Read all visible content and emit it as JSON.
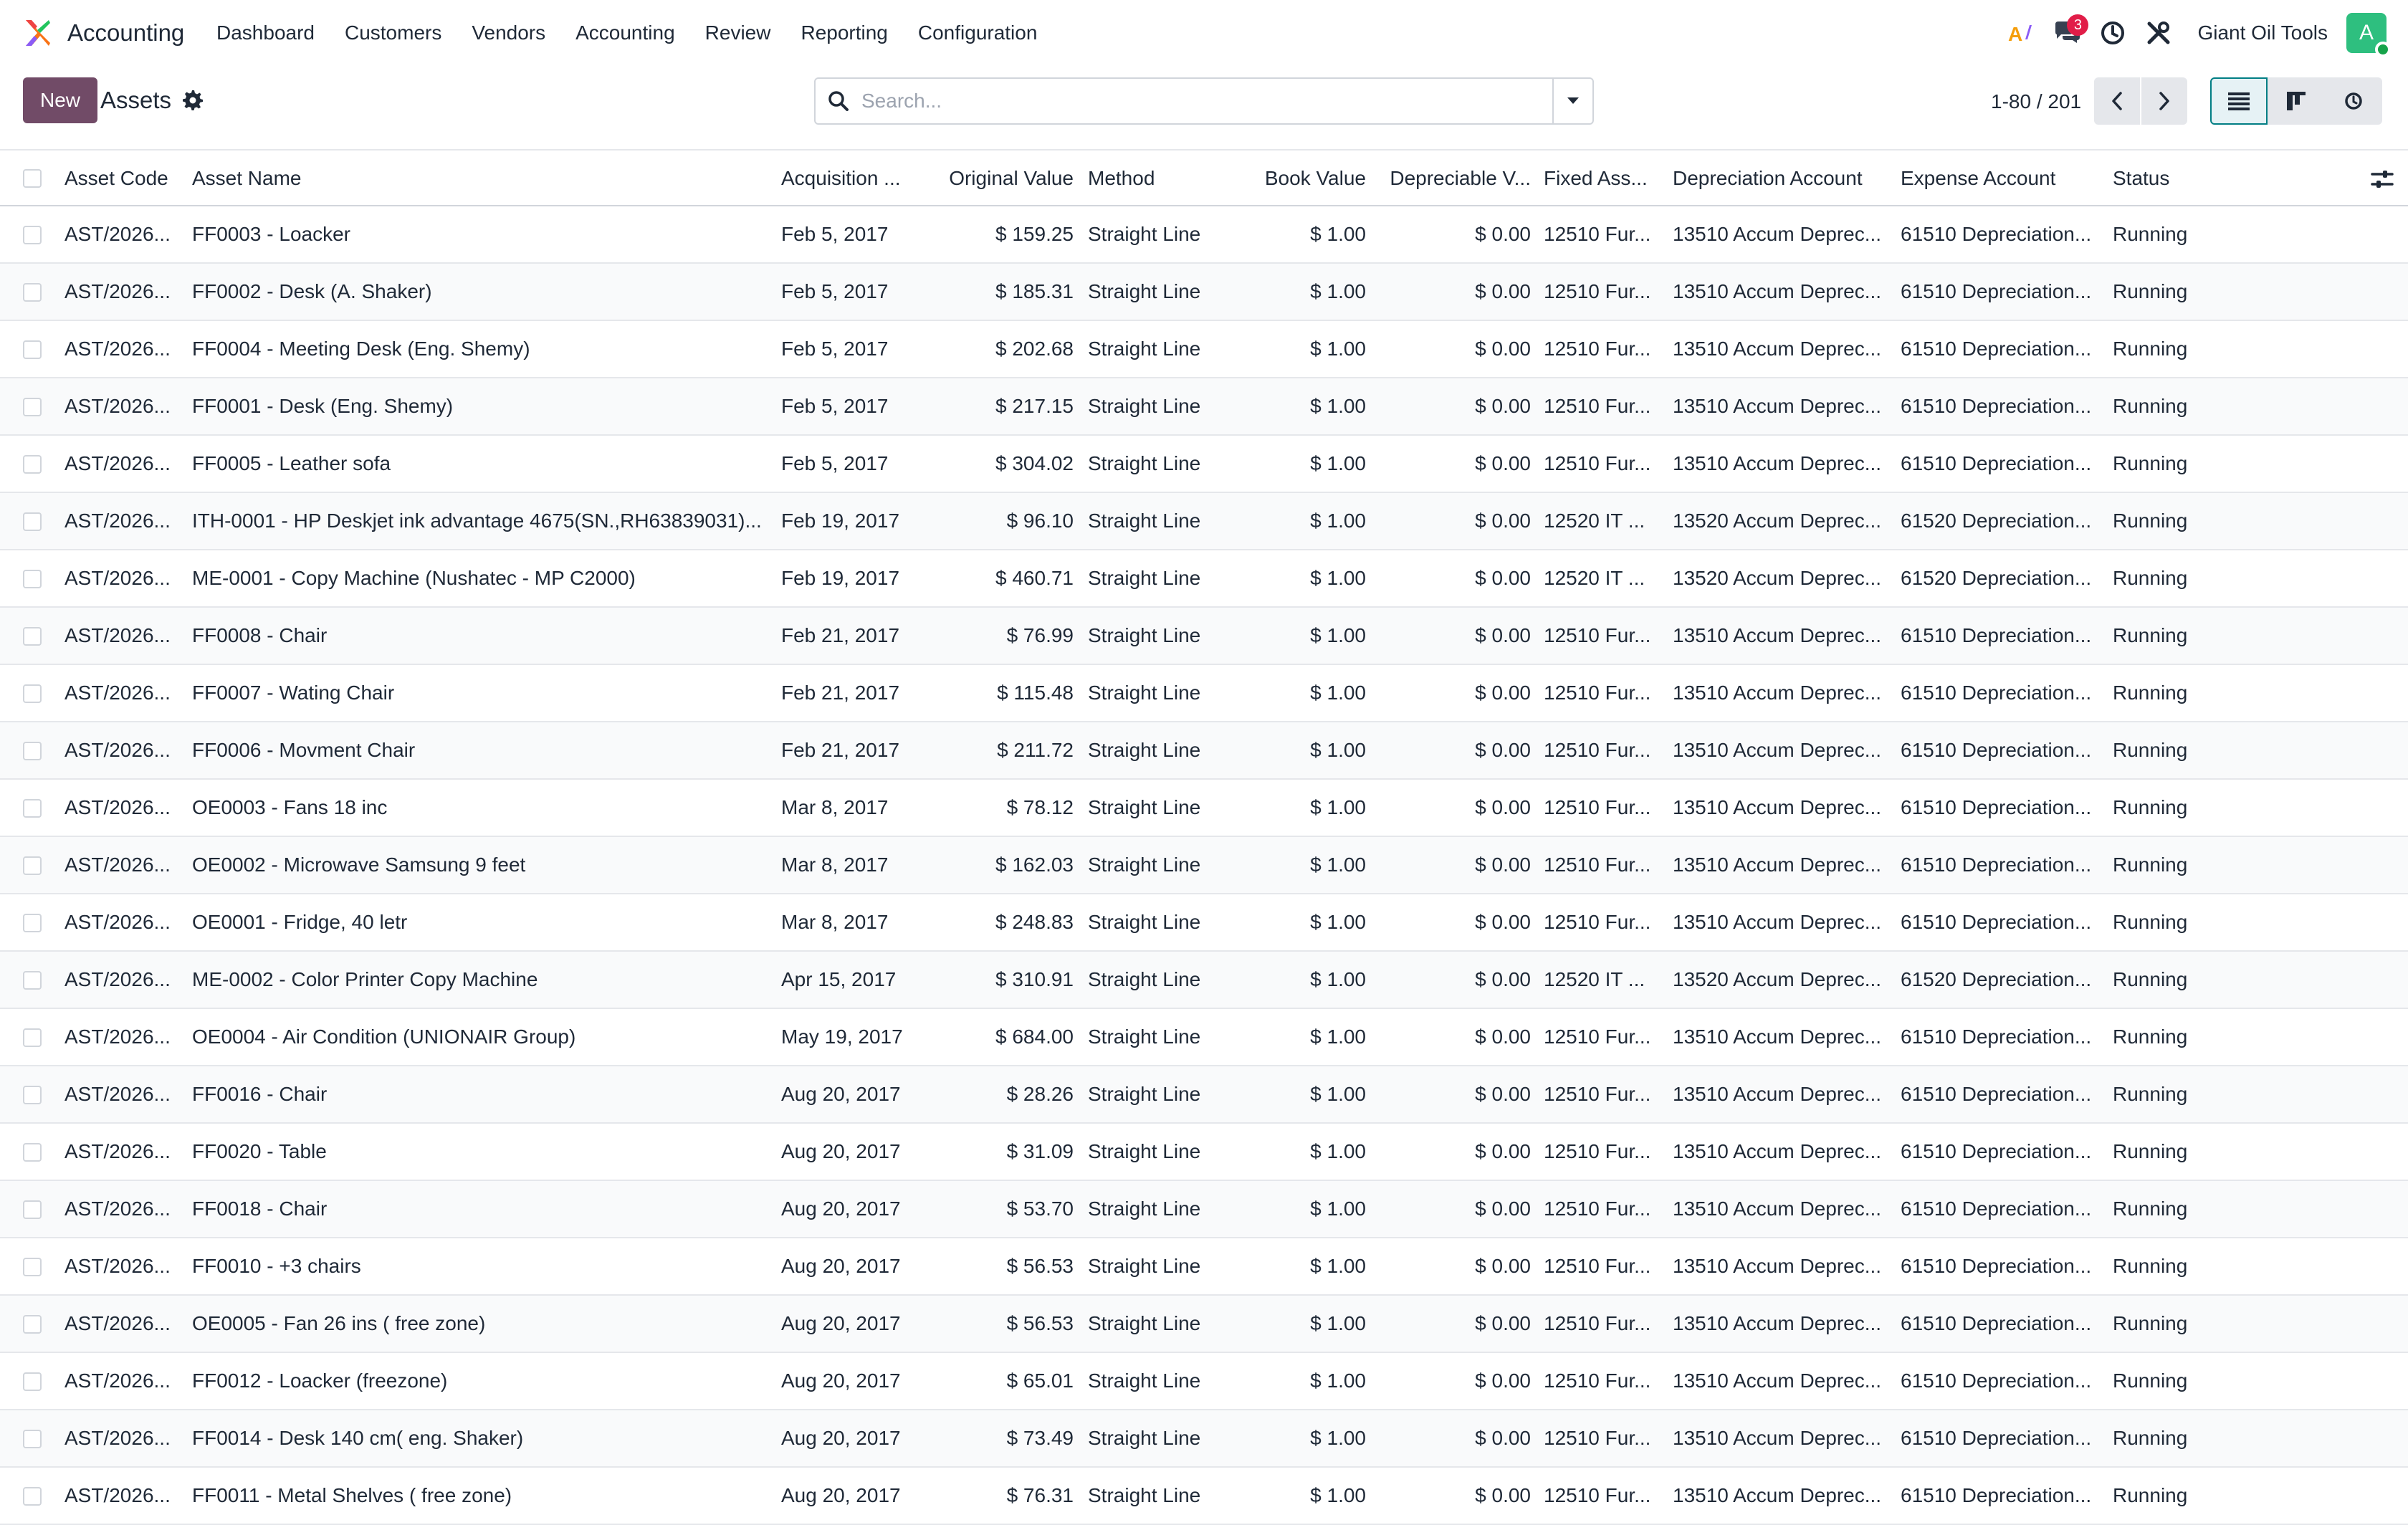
{
  "app": {
    "name": "Accounting"
  },
  "menu": [
    "Dashboard",
    "Customers",
    "Vendors",
    "Accounting",
    "Review",
    "Reporting",
    "Configuration"
  ],
  "nav_right": {
    "ai_icon": "ai-icon",
    "messages_badge": "3",
    "company": "Giant Oil Tools",
    "avatar_letter": "A"
  },
  "control": {
    "new_label": "New",
    "title": "Assets",
    "search_placeholder": "Search...",
    "pager": "1-80 / 201"
  },
  "colors": {
    "primary": "#714b67",
    "accent": "#017e84",
    "badge": "#e11d48",
    "avatar": "#2ebf7f"
  },
  "columns": {
    "code": "Asset Code",
    "name": "Asset Name",
    "date": "Acquisition ...",
    "orig": "Original Value",
    "method": "Method",
    "book": "Book Value",
    "dep": "Depreciable V...",
    "fixed": "Fixed Ass...",
    "depacc": "Depreciation Account",
    "exp": "Expense Account",
    "status": "Status"
  },
  "rows": [
    {
      "code": "AST/2026...",
      "name": "FF0003 - Loacker",
      "date": "Feb 5, 2017",
      "orig": "$ 159.25",
      "method": "Straight Line",
      "book": "$ 1.00",
      "dep": "$ 0.00",
      "fixed": "12510 Fur...",
      "depacc": "13510 Accum Deprec...",
      "exp": "61510 Depreciation...",
      "status": "Running"
    },
    {
      "code": "AST/2026...",
      "name": "FF0002 - Desk (A. Shaker)",
      "date": "Feb 5, 2017",
      "orig": "$ 185.31",
      "method": "Straight Line",
      "book": "$ 1.00",
      "dep": "$ 0.00",
      "fixed": "12510 Fur...",
      "depacc": "13510 Accum Deprec...",
      "exp": "61510 Depreciation...",
      "status": "Running"
    },
    {
      "code": "AST/2026...",
      "name": "FF0004 - Meeting Desk (Eng. Shemy)",
      "date": "Feb 5, 2017",
      "orig": "$ 202.68",
      "method": "Straight Line",
      "book": "$ 1.00",
      "dep": "$ 0.00",
      "fixed": "12510 Fur...",
      "depacc": "13510 Accum Deprec...",
      "exp": "61510 Depreciation...",
      "status": "Running"
    },
    {
      "code": "AST/2026...",
      "name": "FF0001 - Desk (Eng. Shemy)",
      "date": "Feb 5, 2017",
      "orig": "$ 217.15",
      "method": "Straight Line",
      "book": "$ 1.00",
      "dep": "$ 0.00",
      "fixed": "12510 Fur...",
      "depacc": "13510 Accum Deprec...",
      "exp": "61510 Depreciation...",
      "status": "Running"
    },
    {
      "code": "AST/2026...",
      "name": "FF0005 - Leather sofa",
      "date": "Feb 5, 2017",
      "orig": "$ 304.02",
      "method": "Straight Line",
      "book": "$ 1.00",
      "dep": "$ 0.00",
      "fixed": "12510 Fur...",
      "depacc": "13510 Accum Deprec...",
      "exp": "61510 Depreciation...",
      "status": "Running"
    },
    {
      "code": "AST/2026...",
      "name": "ITH-0001 - HP Deskjet ink advantage 4675(SN.,RH63839031)...",
      "date": "Feb 19, 2017",
      "orig": "$ 96.10",
      "method": "Straight Line",
      "book": "$ 1.00",
      "dep": "$ 0.00",
      "fixed": "12520 IT ...",
      "depacc": "13520 Accum Deprec...",
      "exp": "61520 Depreciation...",
      "status": "Running"
    },
    {
      "code": "AST/2026...",
      "name": "ME-0001 - Copy Machine (Nushatec - MP C2000)",
      "date": "Feb 19, 2017",
      "orig": "$ 460.71",
      "method": "Straight Line",
      "book": "$ 1.00",
      "dep": "$ 0.00",
      "fixed": "12520 IT ...",
      "depacc": "13520 Accum Deprec...",
      "exp": "61520 Depreciation...",
      "status": "Running"
    },
    {
      "code": "AST/2026...",
      "name": "FF0008 - Chair",
      "date": "Feb 21, 2017",
      "orig": "$ 76.99",
      "method": "Straight Line",
      "book": "$ 1.00",
      "dep": "$ 0.00",
      "fixed": "12510 Fur...",
      "depacc": "13510 Accum Deprec...",
      "exp": "61510 Depreciation...",
      "status": "Running"
    },
    {
      "code": "AST/2026...",
      "name": "FF0007 - Wating Chair",
      "date": "Feb 21, 2017",
      "orig": "$ 115.48",
      "method": "Straight Line",
      "book": "$ 1.00",
      "dep": "$ 0.00",
      "fixed": "12510 Fur...",
      "depacc": "13510 Accum Deprec...",
      "exp": "61510 Depreciation...",
      "status": "Running"
    },
    {
      "code": "AST/2026...",
      "name": "FF0006 - Movment Chair",
      "date": "Feb 21, 2017",
      "orig": "$ 211.72",
      "method": "Straight Line",
      "book": "$ 1.00",
      "dep": "$ 0.00",
      "fixed": "12510 Fur...",
      "depacc": "13510 Accum Deprec...",
      "exp": "61510 Depreciation...",
      "status": "Running"
    },
    {
      "code": "AST/2026...",
      "name": "OE0003 - Fans 18 inc",
      "date": "Mar 8, 2017",
      "orig": "$ 78.12",
      "method": "Straight Line",
      "book": "$ 1.00",
      "dep": "$ 0.00",
      "fixed": "12510 Fur...",
      "depacc": "13510 Accum Deprec...",
      "exp": "61510 Depreciation...",
      "status": "Running"
    },
    {
      "code": "AST/2026...",
      "name": "OE0002 - Microwave Samsung 9 feet",
      "date": "Mar 8, 2017",
      "orig": "$ 162.03",
      "method": "Straight Line",
      "book": "$ 1.00",
      "dep": "$ 0.00",
      "fixed": "12510 Fur...",
      "depacc": "13510 Accum Deprec...",
      "exp": "61510 Depreciation...",
      "status": "Running"
    },
    {
      "code": "AST/2026...",
      "name": "OE0001 - Fridge, 40 letr",
      "date": "Mar 8, 2017",
      "orig": "$ 248.83",
      "method": "Straight Line",
      "book": "$ 1.00",
      "dep": "$ 0.00",
      "fixed": "12510 Fur...",
      "depacc": "13510 Accum Deprec...",
      "exp": "61510 Depreciation...",
      "status": "Running"
    },
    {
      "code": "AST/2026...",
      "name": "ME-0002 - Color Printer Copy Machine",
      "date": "Apr 15, 2017",
      "orig": "$ 310.91",
      "method": "Straight Line",
      "book": "$ 1.00",
      "dep": "$ 0.00",
      "fixed": "12520 IT ...",
      "depacc": "13520 Accum Deprec...",
      "exp": "61520 Depreciation...",
      "status": "Running"
    },
    {
      "code": "AST/2026...",
      "name": "OE0004 - Air Condition (UNIONAIR Group)",
      "date": "May 19, 2017",
      "orig": "$ 684.00",
      "method": "Straight Line",
      "book": "$ 1.00",
      "dep": "$ 0.00",
      "fixed": "12510 Fur...",
      "depacc": "13510 Accum Deprec...",
      "exp": "61510 Depreciation...",
      "status": "Running"
    },
    {
      "code": "AST/2026...",
      "name": "FF0016 - Chair",
      "date": "Aug 20, 2017",
      "orig": "$ 28.26",
      "method": "Straight Line",
      "book": "$ 1.00",
      "dep": "$ 0.00",
      "fixed": "12510 Fur...",
      "depacc": "13510 Accum Deprec...",
      "exp": "61510 Depreciation...",
      "status": "Running"
    },
    {
      "code": "AST/2026...",
      "name": "FF0020 - Table",
      "date": "Aug 20, 2017",
      "orig": "$ 31.09",
      "method": "Straight Line",
      "book": "$ 1.00",
      "dep": "$ 0.00",
      "fixed": "12510 Fur...",
      "depacc": "13510 Accum Deprec...",
      "exp": "61510 Depreciation...",
      "status": "Running"
    },
    {
      "code": "AST/2026...",
      "name": "FF0018 - Chair",
      "date": "Aug 20, 2017",
      "orig": "$ 53.70",
      "method": "Straight Line",
      "book": "$ 1.00",
      "dep": "$ 0.00",
      "fixed": "12510 Fur...",
      "depacc": "13510 Accum Deprec...",
      "exp": "61510 Depreciation...",
      "status": "Running"
    },
    {
      "code": "AST/2026...",
      "name": "FF0010 - +3 chairs",
      "date": "Aug 20, 2017",
      "orig": "$ 56.53",
      "method": "Straight Line",
      "book": "$ 1.00",
      "dep": "$ 0.00",
      "fixed": "12510 Fur...",
      "depacc": "13510 Accum Deprec...",
      "exp": "61510 Depreciation...",
      "status": "Running"
    },
    {
      "code": "AST/2026...",
      "name": "OE0005 - Fan 26 ins ( free zone)",
      "date": "Aug 20, 2017",
      "orig": "$ 56.53",
      "method": "Straight Line",
      "book": "$ 1.00",
      "dep": "$ 0.00",
      "fixed": "12510 Fur...",
      "depacc": "13510 Accum Deprec...",
      "exp": "61510 Depreciation...",
      "status": "Running"
    },
    {
      "code": "AST/2026...",
      "name": "FF0012 - Loacker (freezone)",
      "date": "Aug 20, 2017",
      "orig": "$ 65.01",
      "method": "Straight Line",
      "book": "$ 1.00",
      "dep": "$ 0.00",
      "fixed": "12510 Fur...",
      "depacc": "13510 Accum Deprec...",
      "exp": "61510 Depreciation...",
      "status": "Running"
    },
    {
      "code": "AST/2026...",
      "name": "FF0014 - Desk 140 cm( eng. Shaker)",
      "date": "Aug 20, 2017",
      "orig": "$ 73.49",
      "method": "Straight Line",
      "book": "$ 1.00",
      "dep": "$ 0.00",
      "fixed": "12510 Fur...",
      "depacc": "13510 Accum Deprec...",
      "exp": "61510 Depreciation...",
      "status": "Running"
    },
    {
      "code": "AST/2026...",
      "name": "FF0011 - Metal Shelves ( free zone)",
      "date": "Aug 20, 2017",
      "orig": "$ 76.31",
      "method": "Straight Line",
      "book": "$ 1.00",
      "dep": "$ 0.00",
      "fixed": "12510 Fur...",
      "depacc": "13510 Accum Deprec...",
      "exp": "61510 Depreciation...",
      "status": "Running"
    }
  ]
}
